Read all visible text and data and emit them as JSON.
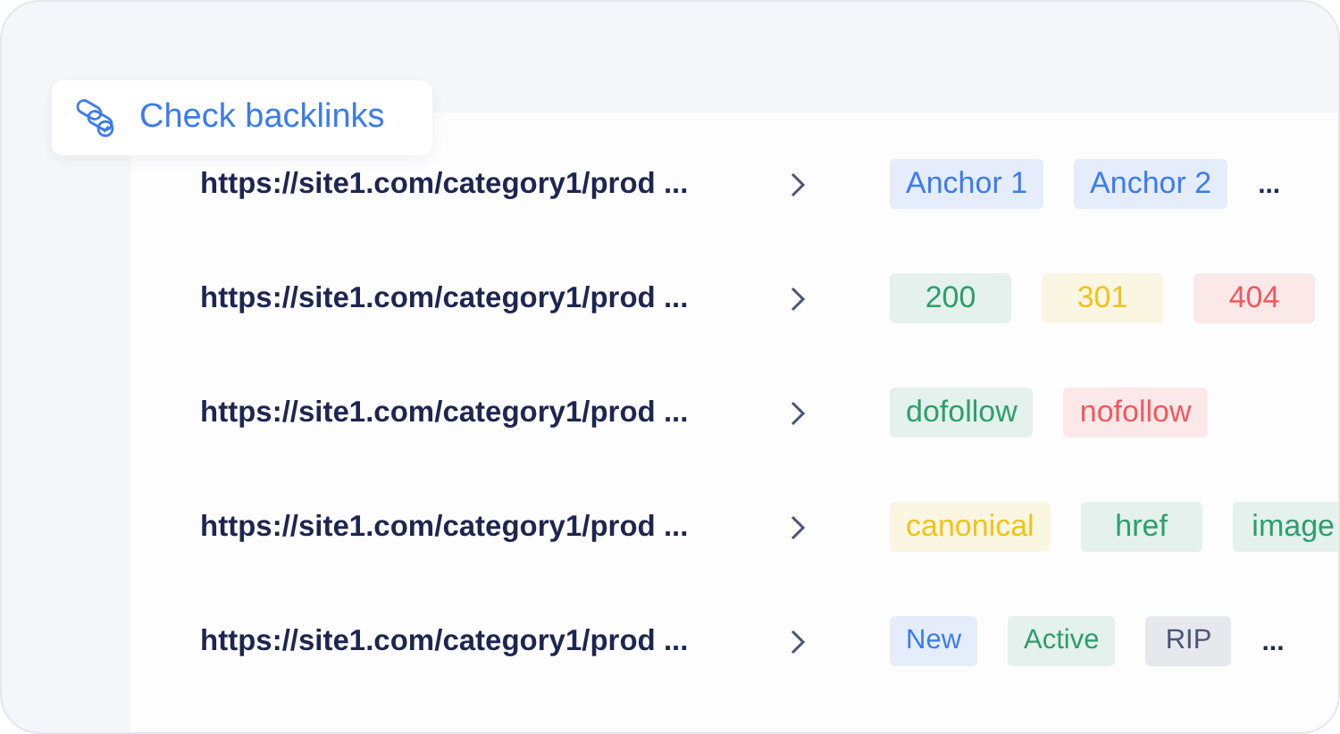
{
  "check_button": {
    "label": "Check backlinks"
  },
  "rows": [
    {
      "url": "https://site1.com/category1/prod ...",
      "tags": [
        {
          "label": "Anchor 1",
          "color": "#3b7bf0"
        },
        {
          "label": "Anchor 2",
          "color": "#3b7bf0"
        }
      ],
      "more": "..."
    },
    {
      "url": "https://site1.com/category1/prod ...",
      "tags": [
        {
          "label": "200",
          "color": "#2e9e6e"
        },
        {
          "label": "301",
          "color": "#f2c21b"
        },
        {
          "label": "404",
          "color": "#f0595c"
        }
      ]
    },
    {
      "url": "https://site1.com/category1/prod ...",
      "tags": [
        {
          "label": "dofollow",
          "color": "#2e9e6e"
        },
        {
          "label": "nofollow",
          "color": "#f0595c"
        }
      ]
    },
    {
      "url": "https://site1.com/category1/prod ...",
      "tags": [
        {
          "label": "canonical",
          "color": "#f2c21b"
        },
        {
          "label": "href",
          "color": "#2e9e6e"
        },
        {
          "label": "image",
          "color": "#2e9e6e"
        }
      ]
    },
    {
      "url": "https://site1.com/category1/prod ...",
      "tags": [
        {
          "label": "New",
          "color": "#3b7bf0"
        },
        {
          "label": "Active",
          "color": "#2e9e6e"
        },
        {
          "label": "RIP",
          "color": "#4a5578"
        }
      ],
      "more": "...",
      "small": true
    }
  ]
}
